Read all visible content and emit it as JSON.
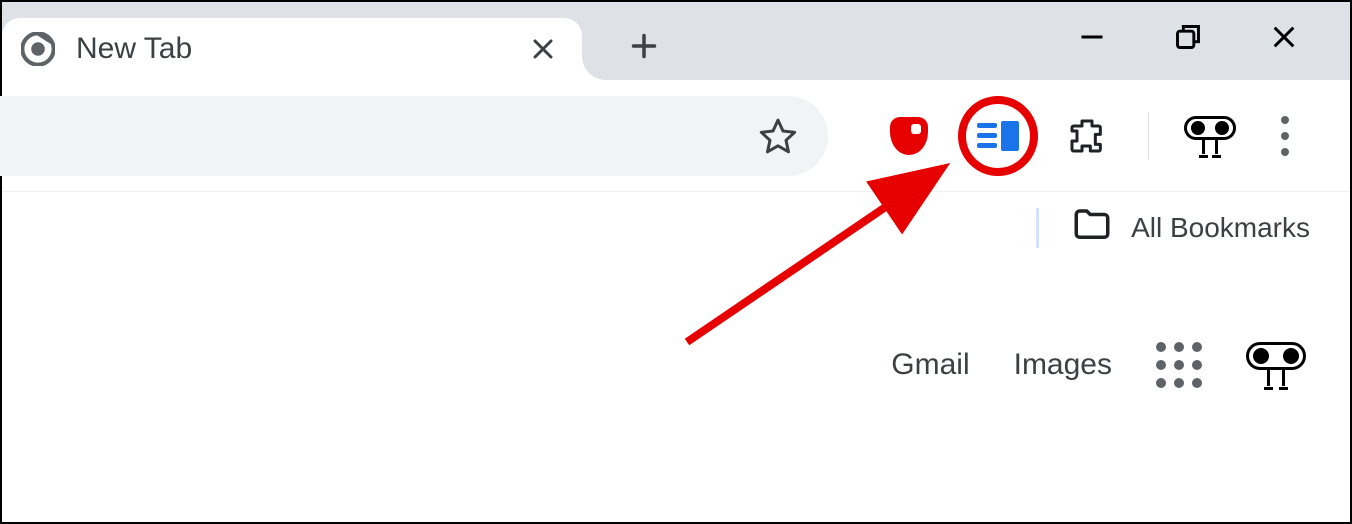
{
  "tab": {
    "title": "New Tab",
    "favicon_name": "chrome-icon"
  },
  "toolbar": {
    "star_name": "bookmark-star-icon",
    "extensions": {
      "ublock_name": "ublock-origin-icon",
      "sidepanel_name": "side-panel-extension-icon",
      "puzzle_name": "extensions-icon",
      "profile_name": "profile-icon"
    },
    "menu_name": "chrome-menu-icon"
  },
  "bookmarks_bar": {
    "all_bookmarks_label": "All Bookmarks",
    "folder_icon_name": "folder-icon"
  },
  "ntp": {
    "gmail_label": "Gmail",
    "images_label": "Images",
    "apps_name": "google-apps-icon",
    "account_name": "account-avatar-icon"
  },
  "window_controls": {
    "min_name": "minimize-icon",
    "max_name": "maximize-restore-icon",
    "close_name": "close-icon"
  },
  "annotation": {
    "highlight_color": "#e60000"
  }
}
